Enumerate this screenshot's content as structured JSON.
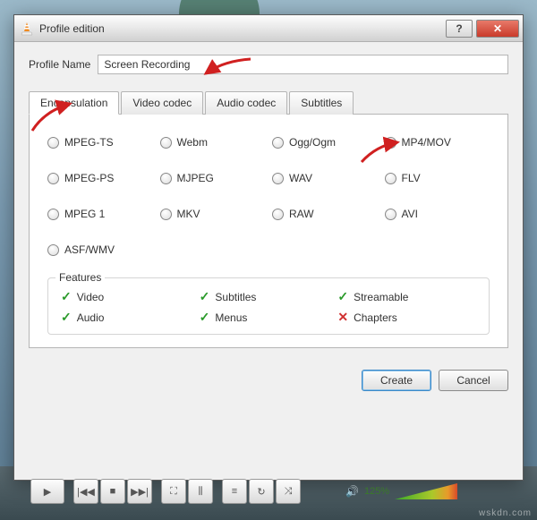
{
  "titlebar": {
    "title": "Profile edition",
    "help": "?",
    "close": "✕"
  },
  "profile": {
    "label": "Profile Name",
    "value": "Screen Recording"
  },
  "tabs": [
    "Encapsulation",
    "Video codec",
    "Audio codec",
    "Subtitles"
  ],
  "active_tab": 0,
  "formats": [
    {
      "label": "MPEG-TS",
      "checked": false
    },
    {
      "label": "Webm",
      "checked": false
    },
    {
      "label": "Ogg/Ogm",
      "checked": false
    },
    {
      "label": "MP4/MOV",
      "checked": true
    },
    {
      "label": "MPEG-PS",
      "checked": false
    },
    {
      "label": "MJPEG",
      "checked": false
    },
    {
      "label": "WAV",
      "checked": false
    },
    {
      "label": "FLV",
      "checked": false
    },
    {
      "label": "MPEG 1",
      "checked": false
    },
    {
      "label": "MKV",
      "checked": false
    },
    {
      "label": "RAW",
      "checked": false
    },
    {
      "label": "AVI",
      "checked": false
    },
    {
      "label": "ASF/WMV",
      "checked": false
    }
  ],
  "features": {
    "title": "Features",
    "items": [
      {
        "label": "Video",
        "ok": true
      },
      {
        "label": "Subtitles",
        "ok": true
      },
      {
        "label": "Streamable",
        "ok": true
      },
      {
        "label": "Audio",
        "ok": true
      },
      {
        "label": "Menus",
        "ok": true
      },
      {
        "label": "Chapters",
        "ok": false
      }
    ]
  },
  "buttons": {
    "create": "Create",
    "cancel": "Cancel"
  },
  "player": {
    "volume": "125%"
  },
  "watermark": "wskdn.com"
}
